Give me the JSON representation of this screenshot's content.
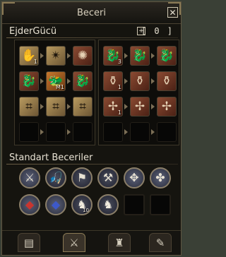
{
  "window": {
    "title": "Beceri",
    "close_label": "✕"
  },
  "skill_tree": {
    "name": "EjderGücü",
    "plus_label": "+",
    "points": "[ 0 ]"
  },
  "standard": {
    "title": "Standart Beceriler"
  },
  "left_panel": {
    "skills": [
      {
        "glyph": "✋",
        "count": "1"
      },
      {
        "glyph": "✴",
        "count": ""
      },
      {
        "glyph": "✺",
        "count": ""
      },
      {
        "glyph": "🐉",
        "count": ""
      },
      {
        "glyph": "🐲",
        "count": "M1"
      },
      {
        "glyph": "🐉",
        "count": ""
      },
      {
        "glyph": "⌗",
        "count": ""
      },
      {
        "glyph": "⌗",
        "count": ""
      },
      {
        "glyph": "⌗",
        "count": ""
      }
    ]
  },
  "right_panel": {
    "skills": [
      {
        "glyph": "🐉",
        "count": "3"
      },
      {
        "glyph": "🐉",
        "count": ""
      },
      {
        "glyph": "🐉",
        "count": ""
      },
      {
        "glyph": "⚱",
        "count": "1"
      },
      {
        "glyph": "⚱",
        "count": ""
      },
      {
        "glyph": "⚱",
        "count": ""
      },
      {
        "glyph": "✢",
        "count": "1"
      },
      {
        "glyph": "✢",
        "count": ""
      },
      {
        "glyph": "✢",
        "count": ""
      }
    ]
  },
  "standard_skills": [
    {
      "glyph": "⚔",
      "count": ""
    },
    {
      "glyph": "🎣",
      "count": ""
    },
    {
      "glyph": "⚑",
      "count": ""
    },
    {
      "glyph": "⚒",
      "count": ""
    },
    {
      "glyph": "✥",
      "count": ""
    },
    {
      "glyph": "✤",
      "count": ""
    },
    {
      "glyph": "◆",
      "count": ""
    },
    {
      "glyph": "◆",
      "count": ""
    },
    {
      "glyph": "♞",
      "count": "10"
    },
    {
      "glyph": "♞",
      "count": ""
    }
  ],
  "bottom_tabs": [
    {
      "glyph": "▤"
    },
    {
      "glyph": "⚔"
    },
    {
      "glyph": "♜"
    },
    {
      "glyph": "✎"
    }
  ],
  "colors": {
    "window_bg": "#15140f",
    "frame": "#5f5540",
    "title_text": "#d8d0bd",
    "skill_tan": "#b89a5f",
    "skill_brown": "#8a4a32"
  }
}
